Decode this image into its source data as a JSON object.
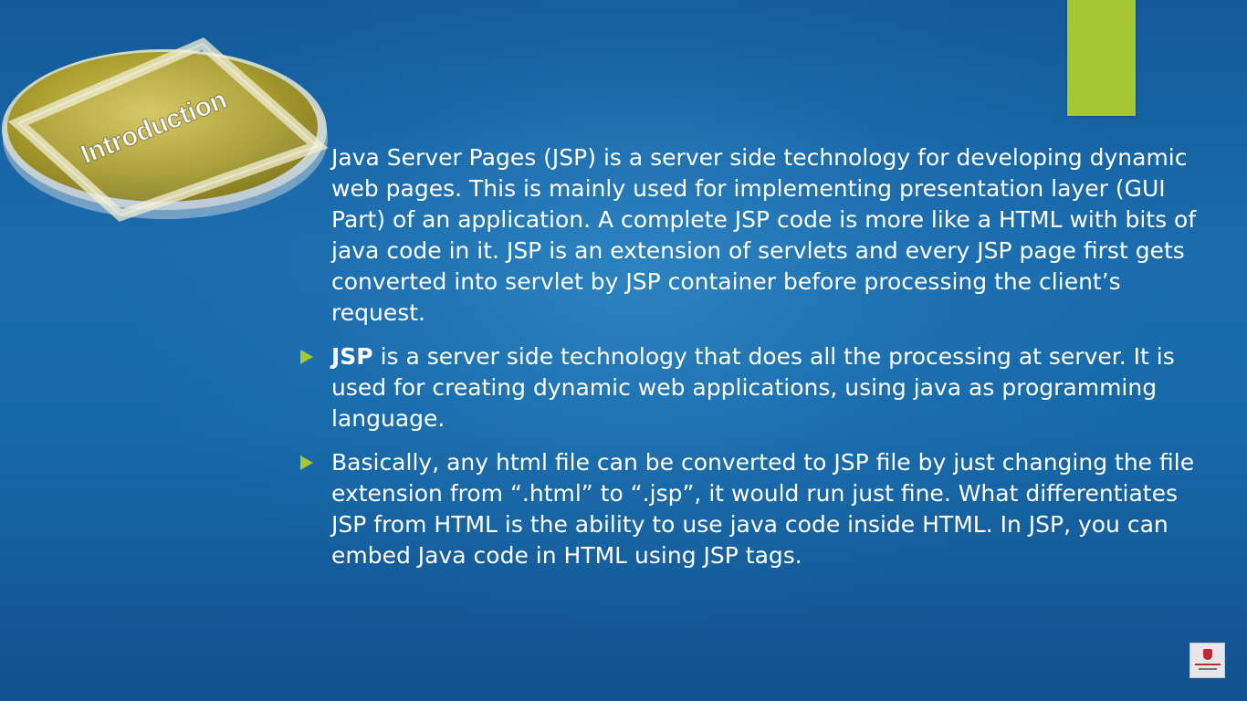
{
  "slide": {
    "badge_label": "Introduction",
    "colors": {
      "accent": "#a5c832",
      "background": "#1a6cad",
      "badge_gold": "#a99d2e",
      "text": "#ffffff"
    },
    "bullets": [
      {
        "bold": "",
        "text": "Java Server Pages (JSP) is a server side technology for developing dynamic web pages. This is mainly used for implementing presentation layer (GUI Part) of an application. A complete JSP code is more like a HTML with bits of java code in it. JSP is an extension of servlets and every JSP page first gets converted into servlet by JSP container before processing the client’s request."
      },
      {
        "bold": "JSP",
        "text": " is a server side technology that does all the processing at server. It is used for creating dynamic web applications, using java as programming language."
      },
      {
        "bold": "",
        "text": "Basically, any html file can be converted to JSP file by just changing the file extension from “.html” to “.jsp”, it would run just fine. What differentiates JSP from HTML is the ability to use java code inside HTML. In JSP, you can embed Java code in HTML using JSP tags."
      }
    ],
    "icons": {
      "bullet": "triangle-right-icon",
      "logo": "channel-logo-icon"
    }
  }
}
